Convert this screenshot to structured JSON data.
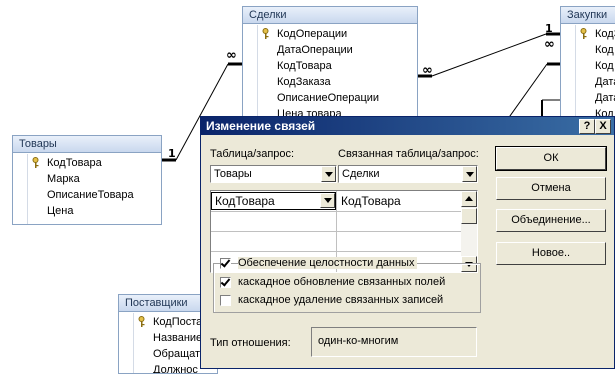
{
  "tables": {
    "tovary": {
      "title": "Товары",
      "fields": [
        "КодТовара",
        "Марка",
        "ОписаниеТовара",
        "Цена"
      ]
    },
    "sdelki": {
      "title": "Сделки",
      "fields": [
        "КодОперации",
        "ДатаОперации",
        "КодТовара",
        "КодЗаказа",
        "ОписаниеОперации",
        "Цена товара"
      ]
    },
    "zakupki": {
      "title": "Закупки",
      "fields": [
        "КодЗ",
        "Код",
        "Код",
        "Дата",
        "Дата",
        "Код"
      ]
    },
    "postavshiki": {
      "title": "Поставщики",
      "fields": [
        "КодПоста",
        "Название",
        "Обращат",
        "Должнос"
      ]
    }
  },
  "cardinality": {
    "one": "1",
    "many": "∞"
  },
  "dialog": {
    "title": "Изменение связей",
    "help_btn": "?",
    "close_btn": "X",
    "table_label": "Таблица/запрос:",
    "related_label": "Связанная таблица/запрос:",
    "table_value": "Товары",
    "related_value": "Сделки",
    "grid": {
      "left": "КодТовара",
      "right": "КодТовара"
    },
    "checks": {
      "integrity": "Обеспечение целостности данных",
      "cascade_update": "каскадное обновление связанных полей",
      "cascade_delete": "каскадное удаление связанных записей"
    },
    "check_state": {
      "integrity": true,
      "cascade_update": true,
      "cascade_delete": false
    },
    "relation_type_label": "Тип отношения:",
    "relation_type_value": "один-ко-многим",
    "buttons": {
      "ok": "ОК",
      "cancel": "Отмена",
      "join": "Объединение...",
      "new": "Новое.."
    }
  }
}
